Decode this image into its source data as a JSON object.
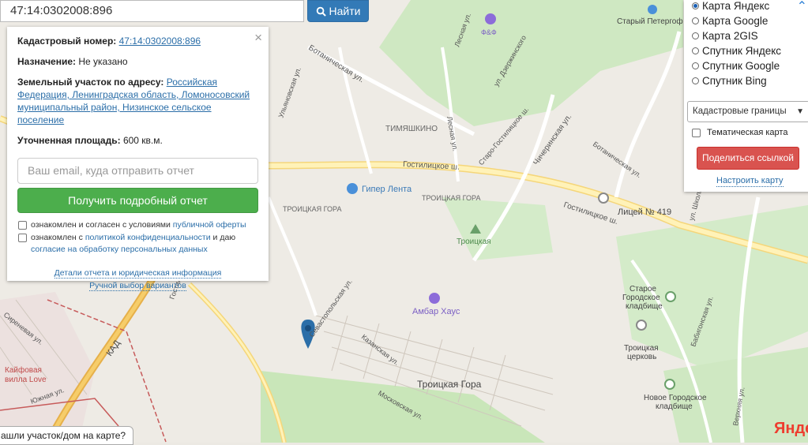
{
  "search": {
    "value": "47:14:0302008:896",
    "button_label": "Найти"
  },
  "info": {
    "cadastral_label": "Кадастровый номер:",
    "cadastral_value": "47:14:0302008:896",
    "purpose_label": "Назначение:",
    "purpose_value": "Не указано",
    "address_label": "Земельный участок по адресу:",
    "address_line1": "Российская",
    "address_line2": "Федерация, Ленинградская область, Ломоносовский",
    "address_line3": "муниципальный район, Низинское сельское поселение",
    "area_label": "Уточненная площадь:",
    "area_value": "600 кв.м.",
    "close_icon": "×",
    "email_placeholder": "Ваш email, куда отправить отчет",
    "get_report": "Получить подробный отчет",
    "check1_text": "ознакомлен и согласен с условиями",
    "check1_link": "публичной оферты",
    "check2_text1": "ознакомлен с",
    "check2_link1": "политикой конфиденциальности",
    "check2_text2": "и даю",
    "check2_link2": "согласие на обработку персональных данных",
    "details_link": "Детали отчета и юридическая информация",
    "manual_link": "Ручной выбор вариантов"
  },
  "map_types": [
    {
      "label": "Карта Яндекс",
      "selected": true
    },
    {
      "label": "Карта Google",
      "selected": false
    },
    {
      "label": "Карта 2GIS",
      "selected": false
    },
    {
      "label": "Спутник Яндекс",
      "selected": false
    },
    {
      "label": "Спутник Google",
      "selected": false
    },
    {
      "label": "Спутник Bing",
      "selected": false
    }
  ],
  "layers_select": "Кадастровые границы",
  "thematic_label": "Тематическая карта",
  "share_button": "Поделиться ссылкой",
  "setup_link": "Настроить карту",
  "bottom_tip": "ашли участок/дом на карте?",
  "provider_logo": "Яндекс",
  "map_labels": {
    "tymyashkino": "ТИМЯШКИНО",
    "giper": "Гипер Лента",
    "troitskaya_gora_upper": "ТРОИЦКАЯ ГОРА",
    "troitskaya_gora_mid": "ТРОИЦКАЯ ГОРА",
    "troitskaya_gora": "Троицкая Гора",
    "troitskaya": "Троицкая",
    "ambar": "Амбар Хаус",
    "liceum": "Лицей № 419",
    "staroe_kladbishe1": "Старое",
    "staroe_kladbishe2": "Городское",
    "staroe_kladbishe3": "кладбище",
    "tserkov1": "Троицкая",
    "tserkov2": "церковь",
    "novoe1": "Новое Городское",
    "novoe2": "кладбище",
    "stary_peterhof": "Старый Петергоф",
    "ff": "Ф&Ф",
    "kad": "КАД",
    "kaifovaya1": "Кайфовая",
    "kaifovaya2": "вилла Love",
    "gostilitskoe": "Гостилицкое ш.",
    "gostilitskoe2": "Гостилицкое ш.",
    "staro_gost": "Старо-Гостилицкое ш.",
    "botanicheskaya": "Ботаническая ул.",
    "botanicheskaya2": "Ботаническая ул.",
    "chicherinskaya": "Чичеринская ул.",
    "kazanskaya": "Казанская ул.",
    "sevastopolskaya": "Севастопольская ул.",
    "moskovskaya": "Московская ул.",
    "lesnaya": "Лесная ул.",
    "lesnaya2": "Лесная ул.",
    "dzerzhinskogo": "ул. Дзержинского",
    "gostinnaya": "Гостилицкая ул.",
    "ulyanovskaya": "Ульяновская ул.",
    "babigonskaya": "Бабигонская ул.",
    "verkhnyaya": "Верхняя ул.",
    "shkolnaya": "ул. Школьная",
    "yuzhnaya": "Южная ул.",
    "sirenevaya": "Сиреневая ул.",
    "peterhof_ul": "Петергоф",
    "gostilitskoe_left": "Гостилицкое ш."
  }
}
